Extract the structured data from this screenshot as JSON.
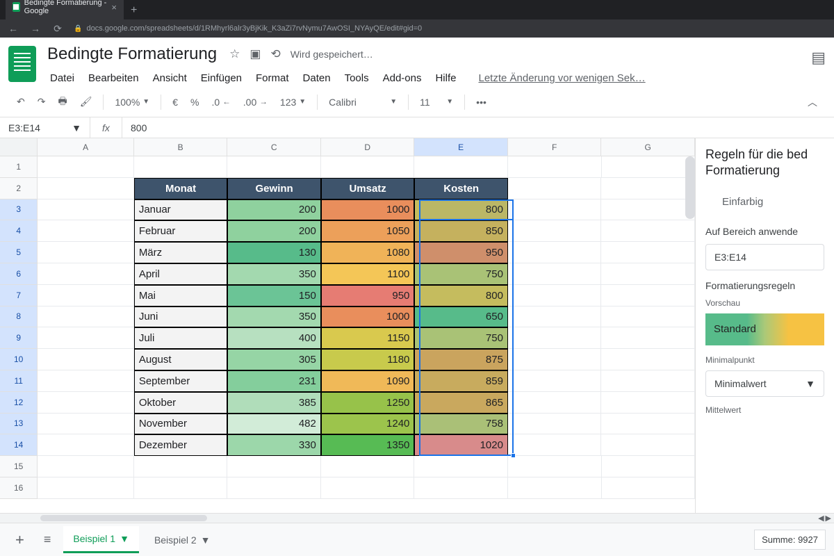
{
  "browser": {
    "tab_title": "Bedingte Formatierung - Google",
    "url": "docs.google.com/spreadsheets/d/1RMhyrl6alr3yBjKik_K3aZi7rvNymu7AwOSI_NYAyQE/edit#gid=0"
  },
  "doc": {
    "title": "Bedingte Formatierung",
    "saving": "Wird gespeichert…",
    "last_edit": "Letzte Änderung vor wenigen Sek…"
  },
  "menus": [
    "Datei",
    "Bearbeiten",
    "Ansicht",
    "Einfügen",
    "Format",
    "Daten",
    "Tools",
    "Add-ons",
    "Hilfe"
  ],
  "toolbar": {
    "zoom": "100%",
    "currency": "€",
    "percent": "%",
    "dec_dec": ".0",
    "dec_inc": ".00",
    "more_fmt": "123",
    "font": "Calibri",
    "size": "11"
  },
  "namebox": "E3:E14",
  "formula": "800",
  "columns": [
    "A",
    "B",
    "C",
    "D",
    "E",
    "F",
    "G"
  ],
  "rows": [
    "1",
    "2",
    "3",
    "4",
    "5",
    "6",
    "7",
    "8",
    "9",
    "10",
    "11",
    "12",
    "13",
    "14",
    "15",
    "16"
  ],
  "headers": {
    "monat": "Monat",
    "gewinn": "Gewinn",
    "umsatz": "Umsatz",
    "kosten": "Kosten"
  },
  "data": [
    {
      "m": "Januar",
      "g": 200,
      "u": 1000,
      "k": 800,
      "gc": "#8fd19e",
      "uc": "#e98e5c",
      "kc": "#c5bc5e"
    },
    {
      "m": "Februar",
      "g": 200,
      "u": 1050,
      "k": 850,
      "gc": "#8fd19e",
      "uc": "#eca05a",
      "kc": "#c5b15e"
    },
    {
      "m": "März",
      "g": 130,
      "u": 1080,
      "k": 950,
      "gc": "#57bb8a",
      "uc": "#f0b358",
      "kc": "#cf8f6b"
    },
    {
      "m": "April",
      "g": 350,
      "u": 1100,
      "k": 750,
      "gc": "#a3d9af",
      "uc": "#f4c657",
      "kc": "#a9c276"
    },
    {
      "m": "Mai",
      "g": 150,
      "u": 950,
      "k": 800,
      "gc": "#6bc496",
      "uc": "#e67c73",
      "kc": "#c5bc5e"
    },
    {
      "m": "Juni",
      "g": 350,
      "u": 1000,
      "k": 650,
      "gc": "#a3d9af",
      "uc": "#e98e5c",
      "kc": "#57bb8a"
    },
    {
      "m": "Juli",
      "g": 400,
      "u": 1150,
      "k": 750,
      "gc": "#b7e0c0",
      "uc": "#d9c94e",
      "kc": "#a9c276"
    },
    {
      "m": "August",
      "g": 305,
      "u": 1180,
      "k": 875,
      "gc": "#96d5a5",
      "uc": "#c8ca4c",
      "kc": "#caa45e"
    },
    {
      "m": "September",
      "g": 231,
      "u": 1090,
      "k": 859,
      "gc": "#84ce9c",
      "uc": "#f0b958",
      "kc": "#c8ab5e"
    },
    {
      "m": "Oktober",
      "g": 385,
      "u": 1250,
      "k": 865,
      "gc": "#b0ddba",
      "uc": "#97c24a",
      "kc": "#c9a85e"
    },
    {
      "m": "November",
      "g": 482,
      "u": 1240,
      "k": 758,
      "gc": "#d2ecd8",
      "uc": "#9cc44c",
      "kc": "#aac077"
    },
    {
      "m": "Dezember",
      "g": 330,
      "u": 1350,
      "k": 1020,
      "gc": "#9cd7aa",
      "uc": "#57bb54",
      "kc": "#d88b8b"
    }
  ],
  "sidebar": {
    "title": "Regeln für die bed Formatierung",
    "tab_single": "Einfarbig",
    "apply_label": "Auf Bereich anwende",
    "range": "E3:E14",
    "rules_label": "Formatierungsregeln",
    "preview_label": "Vorschau",
    "preview_text": "Standard",
    "min_label": "Minimalpunkt",
    "min_value": "Minimalwert",
    "mid_label": "Mittelwert"
  },
  "tabs": {
    "t1": "Beispiel 1",
    "t2": "Beispiel 2"
  },
  "status": {
    "sum": "Summe: 9927"
  }
}
